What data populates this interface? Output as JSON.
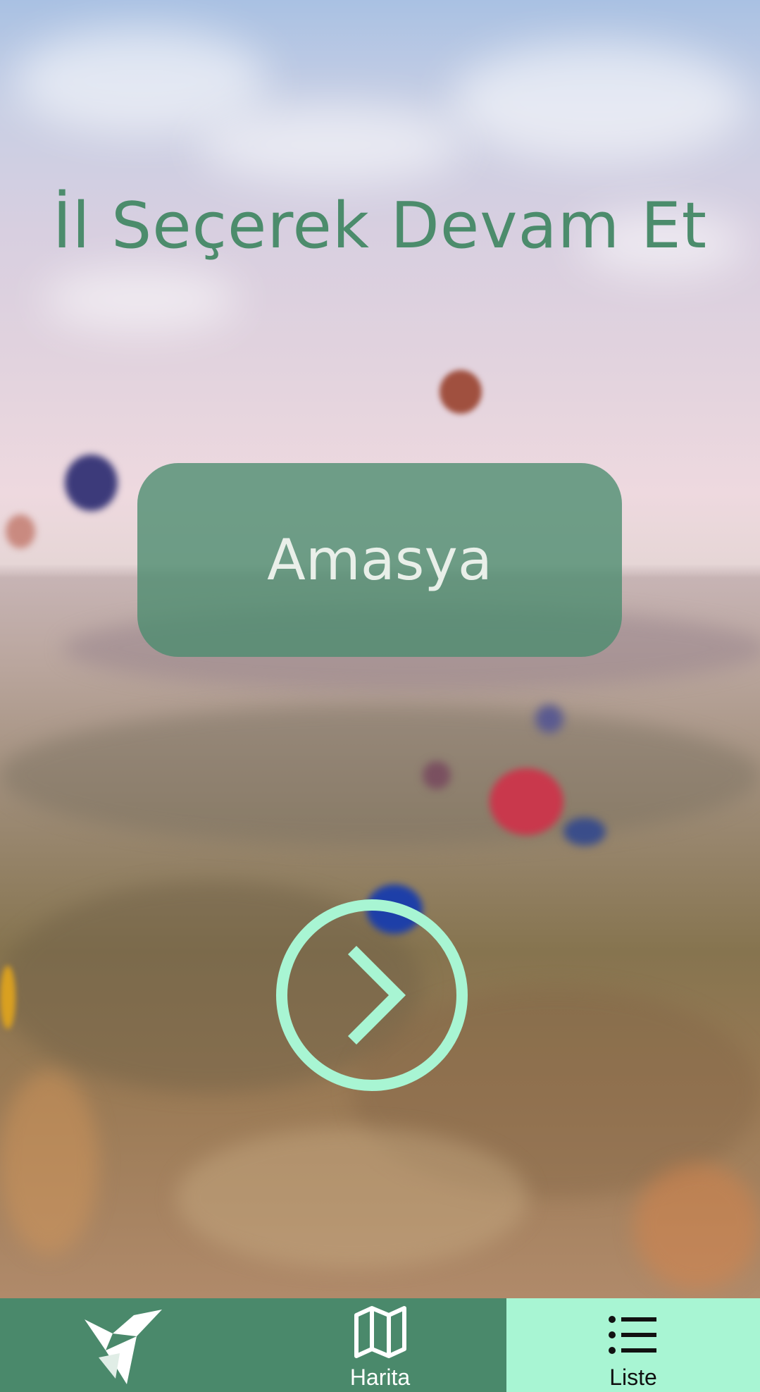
{
  "main": {
    "title": "İl Seçerek Devam Et",
    "selected_city": "Amasya",
    "next_icon": "chevron-right-circle-icon"
  },
  "bottom_nav": {
    "logo_icon": "origami-bird-logo",
    "items": [
      {
        "label": "Harita",
        "icon": "map-icon",
        "active": false
      },
      {
        "label": "Liste",
        "icon": "list-icon",
        "active": true
      }
    ]
  },
  "colors": {
    "title": "#4c8c6c",
    "nav_background": "#4a896b",
    "nav_active": "#a8f5d3",
    "accent": "#a8f5d3"
  }
}
